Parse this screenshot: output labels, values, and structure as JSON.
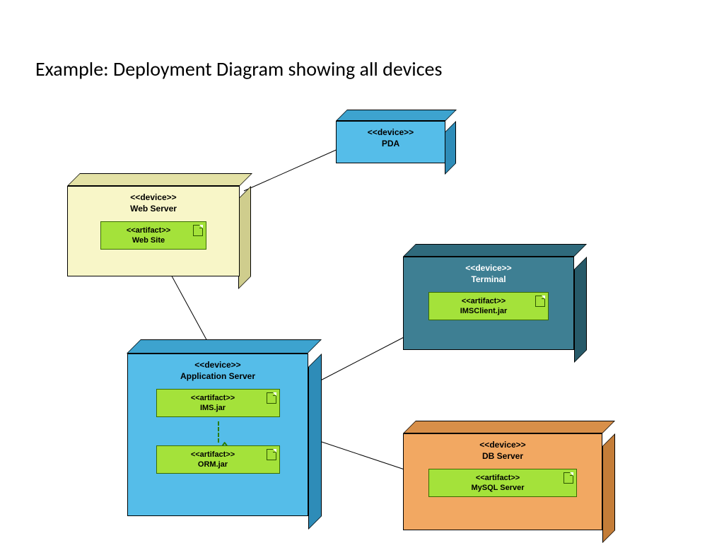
{
  "title": "Example: Deployment Diagram showing all devices",
  "stereotype_device": "<<device>>",
  "stereotype_artifact": "<<artifact>>",
  "nodes": {
    "web_server": {
      "name": "Web Server",
      "artifact": "Web Site"
    },
    "pda": {
      "name": "PDA"
    },
    "application_server": {
      "name": "Application Server",
      "artifact1": "IMS.jar",
      "artifact2": "ORM.jar"
    },
    "terminal": {
      "name": "Terminal",
      "artifact": "IMSClient.jar"
    },
    "db_server": {
      "name": "DB Server",
      "artifact": "MySQL Server"
    }
  },
  "colors": {
    "web_server": "#f8f6c8",
    "pda": "#55bde9",
    "application_server": "#55bde9",
    "terminal": "#3e7f93",
    "db_server": "#f2a862",
    "artifact": "#a4e23a"
  }
}
